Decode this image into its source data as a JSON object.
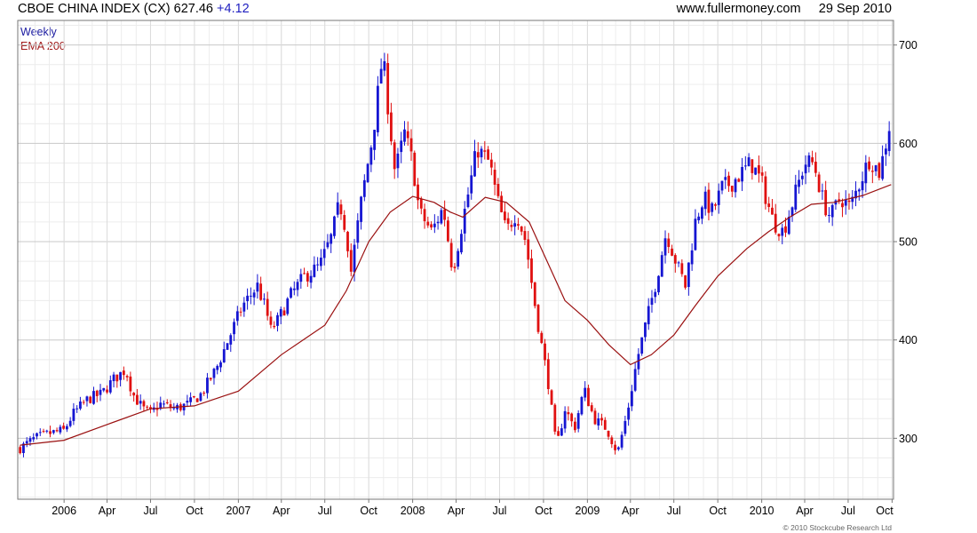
{
  "header": {
    "title": "CBOE CHINA INDEX (CX)",
    "last": "627.46",
    "change": "+4.12",
    "site": "www.fullermoney.com",
    "date": "29 Sep 2010"
  },
  "legend": {
    "frequency": "Weekly",
    "ema": "EMA 200"
  },
  "copyright": "© 2010 Stockcube Research Ltd",
  "colors": {
    "up": "#1515d2",
    "down": "#e01010",
    "ema": "#9a1010",
    "grid": "#d8d8d8",
    "axis": "#777777"
  },
  "chart_data": {
    "type": "candlestick",
    "frequency": "weekly",
    "xlim": [
      "2005-09-26",
      "2010-10-04"
    ],
    "ylim": [
      238,
      725
    ],
    "y_ticks": [
      300,
      400,
      500,
      600,
      700
    ],
    "x_ticks": [
      {
        "label": "2006",
        "date": "2006-01-01"
      },
      {
        "label": "Apr",
        "date": "2006-04-01"
      },
      {
        "label": "Jul",
        "date": "2006-07-01"
      },
      {
        "label": "Oct",
        "date": "2006-10-01"
      },
      {
        "label": "2007",
        "date": "2007-01-01"
      },
      {
        "label": "Apr",
        "date": "2007-04-01"
      },
      {
        "label": "Jul",
        "date": "2007-07-01"
      },
      {
        "label": "Oct",
        "date": "2007-10-01"
      },
      {
        "label": "2008",
        "date": "2008-01-01"
      },
      {
        "label": "Apr",
        "date": "2008-04-01"
      },
      {
        "label": "Jul",
        "date": "2008-07-01"
      },
      {
        "label": "Oct",
        "date": "2008-10-01"
      },
      {
        "label": "2009",
        "date": "2009-01-01"
      },
      {
        "label": "Apr",
        "date": "2009-04-01"
      },
      {
        "label": "Jul",
        "date": "2009-07-01"
      },
      {
        "label": "Oct",
        "date": "2009-10-01"
      },
      {
        "label": "2010",
        "date": "2010-01-01"
      },
      {
        "label": "Apr",
        "date": "2010-04-01"
      },
      {
        "label": "Jul",
        "date": "2010-07-01"
      },
      {
        "label": "Oct",
        "date": "2010-10-01"
      }
    ],
    "close_path": [
      [
        "2005-10-01",
        290
      ],
      [
        "2005-11-01",
        300
      ],
      [
        "2005-12-01",
        305
      ],
      [
        "2006-01-01",
        308
      ],
      [
        "2006-01-20",
        325
      ],
      [
        "2006-02-20",
        340
      ],
      [
        "2006-03-20",
        345
      ],
      [
        "2006-04-15",
        360
      ],
      [
        "2006-05-10",
        370
      ],
      [
        "2006-05-25",
        345
      ],
      [
        "2006-06-15",
        330
      ],
      [
        "2006-07-01",
        325
      ],
      [
        "2006-07-20",
        335
      ],
      [
        "2006-08-20",
        330
      ],
      [
        "2006-09-20",
        335
      ],
      [
        "2006-10-15",
        345
      ],
      [
        "2006-11-15",
        370
      ],
      [
        "2006-12-15",
        405
      ],
      [
        "2007-01-10",
        435
      ],
      [
        "2007-02-10",
        455
      ],
      [
        "2007-02-28",
        430
      ],
      [
        "2007-03-10",
        410
      ],
      [
        "2007-03-25",
        420
      ],
      [
        "2007-04-20",
        445
      ],
      [
        "2007-05-20",
        465
      ],
      [
        "2007-06-20",
        475
      ],
      [
        "2007-07-15",
        505
      ],
      [
        "2007-08-01",
        540
      ],
      [
        "2007-08-15",
        510
      ],
      [
        "2007-08-25",
        470
      ],
      [
        "2007-09-15",
        540
      ],
      [
        "2007-10-10",
        610
      ],
      [
        "2007-10-30",
        690
      ],
      [
        "2007-11-10",
        640
      ],
      [
        "2007-11-25",
        570
      ],
      [
        "2007-12-15",
        610
      ],
      [
        "2008-01-01",
        580
      ],
      [
        "2008-01-15",
        530
      ],
      [
        "2008-02-10",
        510
      ],
      [
        "2008-03-05",
        535
      ],
      [
        "2008-03-25",
        470
      ],
      [
        "2008-04-10",
        510
      ],
      [
        "2008-05-01",
        560
      ],
      [
        "2008-05-15",
        595
      ],
      [
        "2008-06-10",
        580
      ],
      [
        "2008-06-25",
        545
      ],
      [
        "2008-07-15",
        510
      ],
      [
        "2008-08-05",
        530
      ],
      [
        "2008-08-25",
        500
      ],
      [
        "2008-09-10",
        445
      ],
      [
        "2008-09-25",
        400
      ],
      [
        "2008-10-10",
        360
      ],
      [
        "2008-10-28",
        290
      ],
      [
        "2008-11-15",
        330
      ],
      [
        "2008-12-05",
        310
      ],
      [
        "2008-12-25",
        350
      ],
      [
        "2009-01-15",
        320
      ],
      [
        "2009-02-10",
        310
      ],
      [
        "2009-03-05",
        285
      ],
      [
        "2009-03-25",
        325
      ],
      [
        "2009-04-15",
        380
      ],
      [
        "2009-05-05",
        420
      ],
      [
        "2009-05-25",
        460
      ],
      [
        "2009-06-15",
        510
      ],
      [
        "2009-07-05",
        480
      ],
      [
        "2009-07-25",
        455
      ],
      [
        "2009-08-15",
        520
      ],
      [
        "2009-09-01",
        545
      ],
      [
        "2009-09-20",
        530
      ],
      [
        "2009-10-10",
        555
      ],
      [
        "2009-10-30",
        560
      ],
      [
        "2009-11-20",
        570
      ],
      [
        "2009-12-10",
        580
      ],
      [
        "2010-01-01",
        560
      ],
      [
        "2010-01-25",
        520
      ],
      [
        "2010-02-15",
        510
      ],
      [
        "2010-03-10",
        545
      ],
      [
        "2010-04-01",
        580
      ],
      [
        "2010-04-20",
        580
      ],
      [
        "2010-05-10",
        540
      ],
      [
        "2010-05-25",
        525
      ],
      [
        "2010-06-15",
        545
      ],
      [
        "2010-07-05",
        535
      ],
      [
        "2010-07-25",
        560
      ],
      [
        "2010-08-15",
        585
      ],
      [
        "2010-09-05",
        570
      ],
      [
        "2010-09-20",
        605
      ],
      [
        "2010-09-29",
        627.46
      ]
    ],
    "ema_200": [
      [
        "2005-10-01",
        293
      ],
      [
        "2006-01-01",
        298
      ],
      [
        "2006-04-01",
        314
      ],
      [
        "2006-07-01",
        330
      ],
      [
        "2006-10-01",
        333
      ],
      [
        "2007-01-01",
        348
      ],
      [
        "2007-04-01",
        385
      ],
      [
        "2007-07-01",
        415
      ],
      [
        "2007-08-15",
        450
      ],
      [
        "2007-10-01",
        500
      ],
      [
        "2007-11-15",
        530
      ],
      [
        "2008-01-01",
        546
      ],
      [
        "2008-02-15",
        540
      ],
      [
        "2008-03-20",
        530
      ],
      [
        "2008-04-15",
        525
      ],
      [
        "2008-06-01",
        545
      ],
      [
        "2008-07-15",
        540
      ],
      [
        "2008-09-01",
        520
      ],
      [
        "2008-10-01",
        488
      ],
      [
        "2008-11-15",
        440
      ],
      [
        "2009-01-01",
        420
      ],
      [
        "2009-02-15",
        395
      ],
      [
        "2009-04-01",
        375
      ],
      [
        "2009-05-15",
        385
      ],
      [
        "2009-07-01",
        405
      ],
      [
        "2009-08-15",
        435
      ],
      [
        "2009-10-01",
        465
      ],
      [
        "2009-12-01",
        493
      ],
      [
        "2010-01-15",
        510
      ],
      [
        "2010-03-01",
        525
      ],
      [
        "2010-04-15",
        538
      ],
      [
        "2010-06-01",
        540
      ],
      [
        "2010-08-01",
        547
      ],
      [
        "2010-09-29",
        558
      ]
    ]
  }
}
